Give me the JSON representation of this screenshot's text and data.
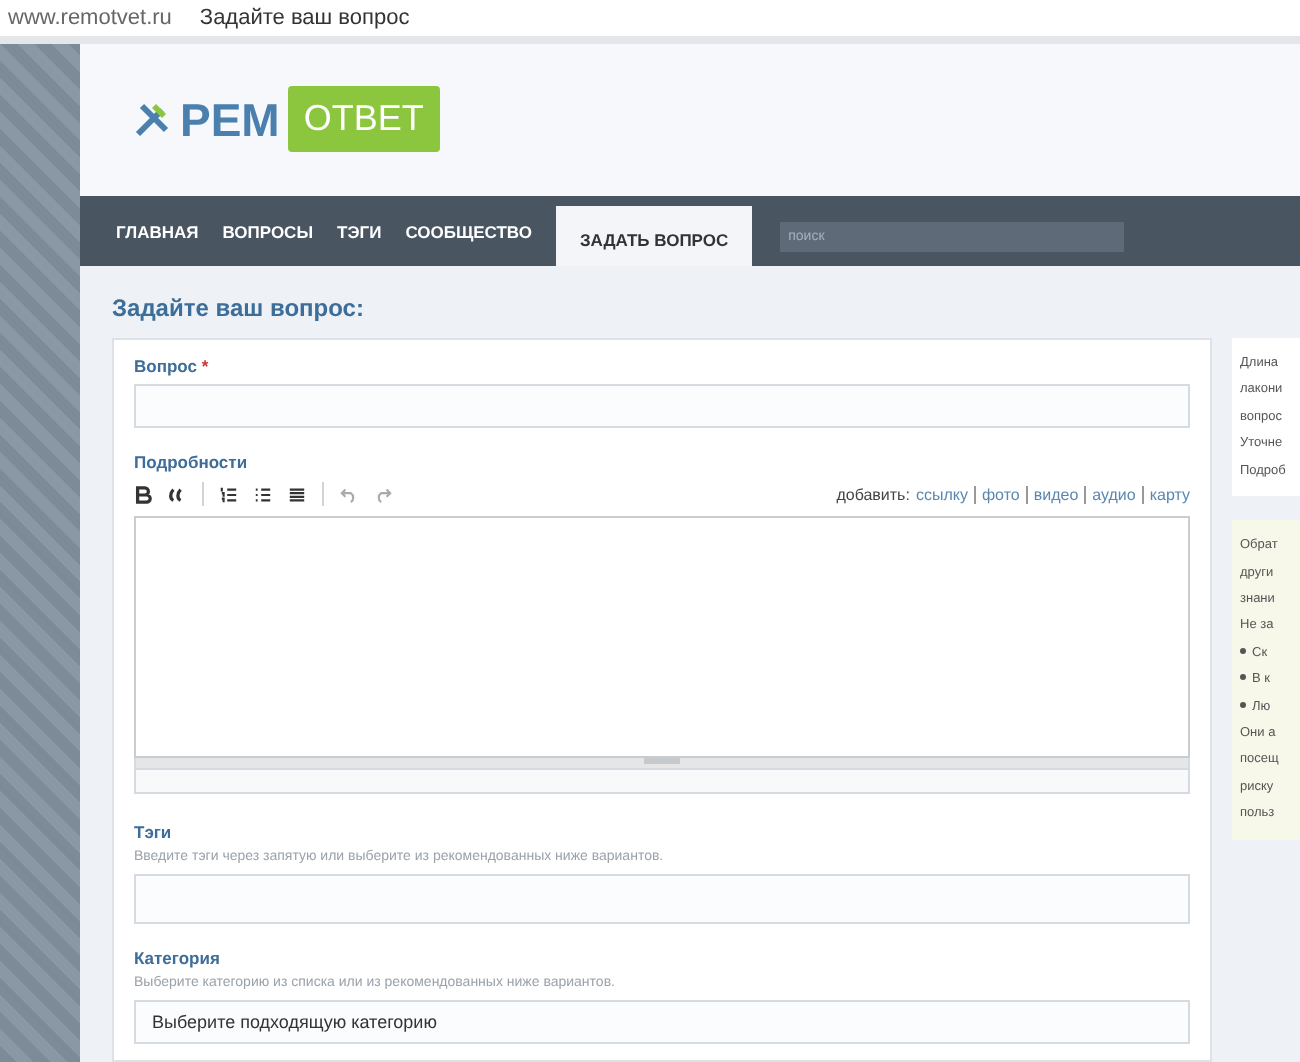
{
  "address_bar": {
    "url": "www.remotvet.ru",
    "page_title": "Задайте ваш вопрос"
  },
  "logo": {
    "left": "РЕМ",
    "right": "ОТВЕТ"
  },
  "nav": {
    "items": [
      {
        "label": "ГЛАВНАЯ",
        "selected": false
      },
      {
        "label": "ВОПРОСЫ",
        "selected": false
      },
      {
        "label": "ТЭГИ",
        "selected": false
      },
      {
        "label": "СООБЩЕСТВО",
        "selected": false
      },
      {
        "label": "ЗАДАТЬ ВОПРОС",
        "selected": true
      }
    ],
    "search": {
      "placeholder": "поиск"
    }
  },
  "heading": "Задайте ваш вопрос:",
  "form": {
    "question": {
      "label": "Вопрос",
      "required_mark": "*"
    },
    "details": {
      "label": "Подробности",
      "add_label": "добавить:",
      "add_links": [
        "ссылку",
        "фото",
        "видео",
        "аудио",
        "карту"
      ]
    },
    "tags": {
      "label": "Тэги",
      "hint": "Введите тэги через запятую или выберите из рекомендованных ниже вариантов."
    },
    "category": {
      "label": "Категория",
      "hint": "Выберите категорию из списка или из рекомендованных ниже вариантов.",
      "value": "Выберите подходящую категорию"
    }
  },
  "side_panels": [
    {
      "lines": [
        "Длина",
        "лакони",
        "вопрос",
        "Уточне",
        "Подроб"
      ]
    },
    {
      "lines": [
        "Обрат",
        "други",
        "знани",
        "Не за"
      ],
      "bullets": [
        "Ск",
        "В к",
        "Лю"
      ],
      "tail": [
        "Они а",
        "посещ",
        "риску",
        "польз"
      ]
    }
  ]
}
